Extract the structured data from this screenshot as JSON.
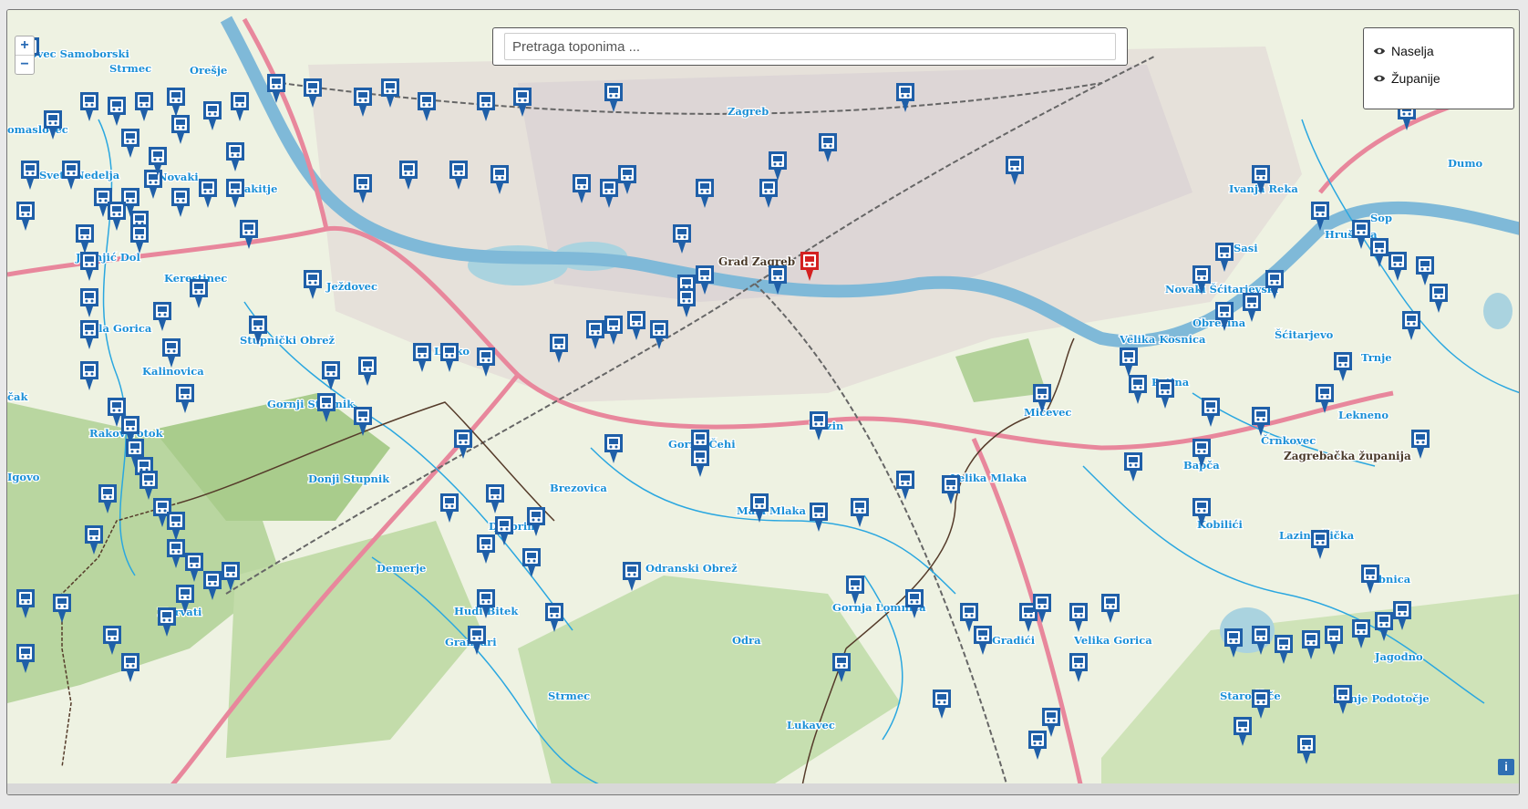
{
  "search": {
    "placeholder": "Pretraga toponima ..."
  },
  "layers": [
    {
      "label": "Naselja",
      "icon": "eye-icon"
    },
    {
      "label": "Županije",
      "icon": "eye-icon"
    }
  ],
  "zoom": {
    "in_label": "+",
    "out_label": "−"
  },
  "info_label": "i",
  "colors": {
    "stop_marker": "#1f5fa8",
    "selected_marker": "#d42020",
    "motorway": "#e8879c",
    "river": "#7fb9d8",
    "stream": "#2aa7e0",
    "forest": "#b9d6a0",
    "label_blue": "#1a8fd6"
  },
  "place_labels": [
    "ovec Samoborski",
    "Strmec",
    "Orešje",
    "omaslovec",
    "Sveta Nedelja",
    "Novaki",
    "Rakitje",
    "Jagnjić Dol",
    "Kerestinec",
    "Ježdovec",
    "Mala Gorica",
    "Stupnički Obrež",
    "Kalinovica",
    "Lučko",
    "čak",
    "Gornji Stupnik",
    "Rakov Potok",
    "Donji Stupnik",
    "Igovo",
    "Brezovica",
    "Desprim",
    "Demerje",
    "Horvati",
    "Hudi Bitek",
    "Grančari",
    "Odranski Obrež",
    "Strmec",
    "Zagreb",
    "Grad Zagreb",
    "Gornji Čehi",
    "Mala Mlaka",
    "Buzin",
    "Odra",
    "Gornja Lomnica",
    "Gradići",
    "Velika Gorica",
    "Lukavec",
    "Mičevec",
    "Velika Mlaka",
    "Velika Kosnica",
    "Obrezina",
    "Novaki Šćitarjevski",
    "Sasi",
    "Ivanja Reka",
    "Petina",
    "Šćitarjevo",
    "Trnje",
    "Lekneno",
    "Črnkovec",
    "Bapča",
    "Zagrebačka županija",
    "Kobilići",
    "Lazina Čička",
    "Ribnica",
    "Jagodno",
    "Staro Čiče",
    "Donje Podotočje",
    "Hrušćica",
    "Sop",
    "Dumo"
  ],
  "stop_marker_icon": "bus-stop-icon"
}
